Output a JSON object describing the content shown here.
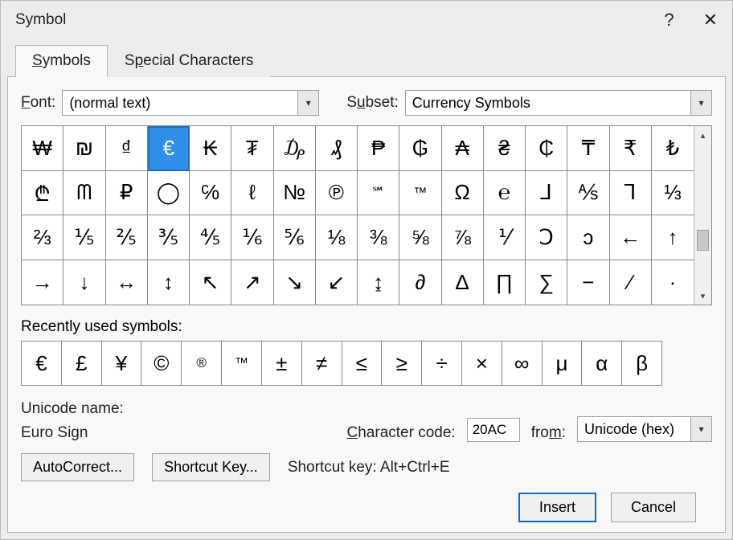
{
  "title": "Symbol",
  "tabs": {
    "symbols": "Symbols",
    "special": "Special Characters"
  },
  "font": {
    "label": "Font:",
    "value": "(normal text)"
  },
  "subset": {
    "label": "Subset:",
    "value": "Currency Symbols"
  },
  "grid_symbols": [
    "₩",
    "₪",
    "₫",
    "€",
    "₭",
    "₮",
    "₯",
    "₰",
    "₱",
    "₲",
    "₳",
    "₴",
    "₵",
    "₸",
    "₹",
    "₺",
    "₾",
    "ᗰ",
    "₽",
    "◯",
    "℅",
    "ℓ",
    "№",
    "℗",
    "℠",
    "™",
    "Ω",
    "℮",
    "⅃",
    "⅍",
    "⅂",
    "⅓",
    "⅔",
    "⅕",
    "⅖",
    "⅗",
    "⅘",
    "⅙",
    "⅚",
    "⅛",
    "⅜",
    "⅝",
    "⅞",
    "⅟",
    "Ↄ",
    "ↄ",
    "←",
    "↑",
    "→",
    "↓",
    "↔",
    "↕",
    "↖",
    "↗",
    "↘",
    "↙",
    "↨",
    "∂",
    "∆",
    "∏",
    "∑",
    "−",
    "∕",
    "∙"
  ],
  "grid_small_indices": [
    24,
    25
  ],
  "selected_index": 3,
  "recent_label": "Recently used symbols:",
  "recent_symbols": [
    "€",
    "£",
    "¥",
    "©",
    "®",
    "™",
    "±",
    "≠",
    "≤",
    "≥",
    "÷",
    "×",
    "∞",
    "μ",
    "α",
    "β"
  ],
  "recent_small_indices": [
    4,
    5
  ],
  "unicode_name_label": "Unicode name:",
  "unicode_name_value": "Euro Sign",
  "char_code": {
    "label": "Character code:",
    "value": "20AC"
  },
  "from": {
    "label": "from:",
    "value": "Unicode (hex)"
  },
  "buttons": {
    "autocorrect": "AutoCorrect...",
    "shortcut_key": "Shortcut Key...",
    "shortcut_label": "Shortcut key: Alt+Ctrl+E",
    "insert": "Insert",
    "cancel": "Cancel"
  }
}
